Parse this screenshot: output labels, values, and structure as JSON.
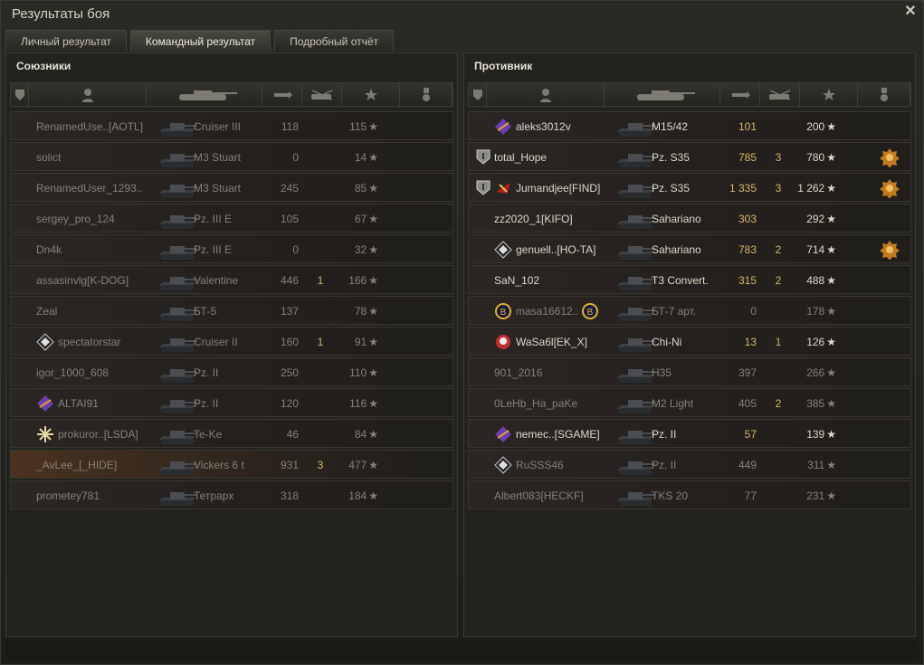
{
  "window": {
    "title": "Результаты боя",
    "close_label": "✕"
  },
  "tabs": [
    {
      "label": "Личный результат"
    },
    {
      "label": "Командный результат"
    },
    {
      "label": "Подробный отчёт"
    }
  ],
  "allies": {
    "title": "Союзники",
    "rows": [
      {
        "name": "RenamedUse..[AOTL]",
        "tank": "Cruiser III",
        "damage": "118",
        "frags": "",
        "xp": "115",
        "state": "dead",
        "clan": "",
        "hl": false
      },
      {
        "name": "solict",
        "tank": "M3 Stuart",
        "damage": "0",
        "frags": "",
        "xp": "14",
        "state": "dead",
        "clan": "",
        "hl": false
      },
      {
        "name": "RenamedUser_1293..",
        "tank": "M3 Stuart",
        "damage": "245",
        "frags": "",
        "xp": "85",
        "state": "dead",
        "clan": "",
        "hl": false
      },
      {
        "name": "sergey_pro_124",
        "tank": "Pz. III E",
        "damage": "105",
        "frags": "",
        "xp": "67",
        "state": "dead",
        "clan": "",
        "hl": false
      },
      {
        "name": "Dn4k",
        "tank": "Pz. III E",
        "damage": "0",
        "frags": "",
        "xp": "32",
        "state": "dead",
        "clan": "",
        "hl": false
      },
      {
        "name": "assasinvlg[K-DOG]",
        "tank": "Valentine",
        "damage": "446",
        "frags": "1",
        "xp": "166",
        "state": "dead",
        "clan": "",
        "hl": false
      },
      {
        "name": "Zeal",
        "tank": "БТ-5",
        "damage": "137",
        "frags": "",
        "xp": "78",
        "state": "dead",
        "clan": "",
        "hl": false
      },
      {
        "name": "spectatorstar",
        "tank": "Cruiser II",
        "damage": "160",
        "frags": "1",
        "xp": "91",
        "state": "dead",
        "clan": "diamond",
        "hl": false
      },
      {
        "name": "igor_1000_608",
        "tank": "Pz. II",
        "damage": "250",
        "frags": "",
        "xp": "110",
        "state": "dead",
        "clan": "",
        "hl": false
      },
      {
        "name": "ALTAI91",
        "tank": "Pz. II",
        "damage": "120",
        "frags": "",
        "xp": "116",
        "state": "dead",
        "clan": "purple",
        "hl": false
      },
      {
        "name": "prokuror..[LSDA]",
        "tank": "Te-Ke",
        "damage": "46",
        "frags": "",
        "xp": "84",
        "state": "dead",
        "clan": "snow",
        "hl": false
      },
      {
        "name": "_AvLee_[_HIDE]",
        "tank": "Vickers 6 t",
        "damage": "931",
        "frags": "3",
        "xp": "477",
        "state": "dead",
        "clan": "",
        "hl": true
      },
      {
        "name": "prometey781",
        "tank": "Тетрарх",
        "damage": "318",
        "frags": "",
        "xp": "184",
        "state": "dead",
        "clan": "",
        "hl": false
      }
    ]
  },
  "enemies": {
    "title": "Противник",
    "rows": [
      {
        "name": "aleks3012v",
        "tank": "M15/42",
        "damage": "101",
        "frags": "",
        "xp": "200",
        "state": "alive",
        "clan": "purple",
        "badge": false,
        "medal": "",
        "hl": false
      },
      {
        "name": "total_Hope",
        "tank": "Pz. S35",
        "damage": "785",
        "frags": "3",
        "xp": "780",
        "state": "alive",
        "clan": "",
        "badge": true,
        "medal": "2",
        "hl": false
      },
      {
        "name": "Jumandjee[FIND]",
        "tank": "Pz. S35",
        "damage": "1 335",
        "frags": "3",
        "xp": "1 262",
        "state": "alive",
        "clan": "red",
        "badge": true,
        "medal": "2",
        "hl": false
      },
      {
        "name": "zz2020_1[KIFO]",
        "tank": "Sahariano",
        "damage": "303",
        "frags": "",
        "xp": "292",
        "state": "alive",
        "clan": "",
        "badge": false,
        "medal": "",
        "hl": false
      },
      {
        "name": "genuell..[HO-TA]",
        "tank": "Sahariano",
        "damage": "783",
        "frags": "2",
        "xp": "714",
        "state": "alive",
        "clan": "diamond",
        "badge": false,
        "medal": " ",
        "hl": false
      },
      {
        "name": "SaN_102",
        "tank": "T3 Convert.",
        "damage": "315",
        "frags": "2",
        "xp": "488",
        "state": "alive",
        "clan": "",
        "badge": false,
        "medal": "",
        "hl": false
      },
      {
        "name": "masa16612..",
        "tank": "БТ-7 арт.",
        "damage": "0",
        "frags": "",
        "xp": "178",
        "state": "dead",
        "clan": "b",
        "badge": false,
        "medal": "",
        "hl": false
      },
      {
        "name": "WaSa6l[EK_X]",
        "tank": "Chi-Ni",
        "damage": "13",
        "frags": "1",
        "xp": "126",
        "state": "alive",
        "clan": "skull",
        "badge": false,
        "medal": "",
        "hl": false
      },
      {
        "name": "901_2016",
        "tank": "H35",
        "damage": "397",
        "frags": "",
        "xp": "266",
        "state": "dead",
        "clan": "",
        "badge": false,
        "medal": "",
        "hl": false
      },
      {
        "name": "0LeHb_Ha_paKe",
        "tank": "M2 Light",
        "damage": "405",
        "frags": "2",
        "xp": "385",
        "state": "dead",
        "clan": "",
        "badge": false,
        "medal": "",
        "hl": false
      },
      {
        "name": "nemec..[SGAME]",
        "tank": "Pz. II",
        "damage": "57",
        "frags": "",
        "xp": "139",
        "state": "alive",
        "clan": "purple",
        "badge": false,
        "medal": "",
        "hl": false
      },
      {
        "name": "RuSSS46",
        "tank": "Pz. II",
        "damage": "449",
        "frags": "",
        "xp": "311",
        "state": "dead",
        "clan": "diamond",
        "badge": false,
        "medal": "",
        "hl": false
      },
      {
        "name": "Albert083[HECKF]",
        "tank": "TKS 20",
        "damage": "77",
        "frags": "",
        "xp": "231",
        "state": "dead",
        "clan": "",
        "badge": false,
        "medal": "",
        "hl": false
      }
    ]
  },
  "icons": {
    "star": "★",
    "medal": "medal-icon",
    "shield": "shield-icon",
    "player": "player-icon",
    "tank": "tank-icon",
    "damage": "damage-icon",
    "frags": "frags-icon",
    "xp": "star-icon",
    "medals": "medal-column-icon"
  },
  "colors": {
    "accent": "#d9b66a",
    "text": "#ded9c8",
    "dim": "#858277",
    "highlight": "#4a3220"
  }
}
